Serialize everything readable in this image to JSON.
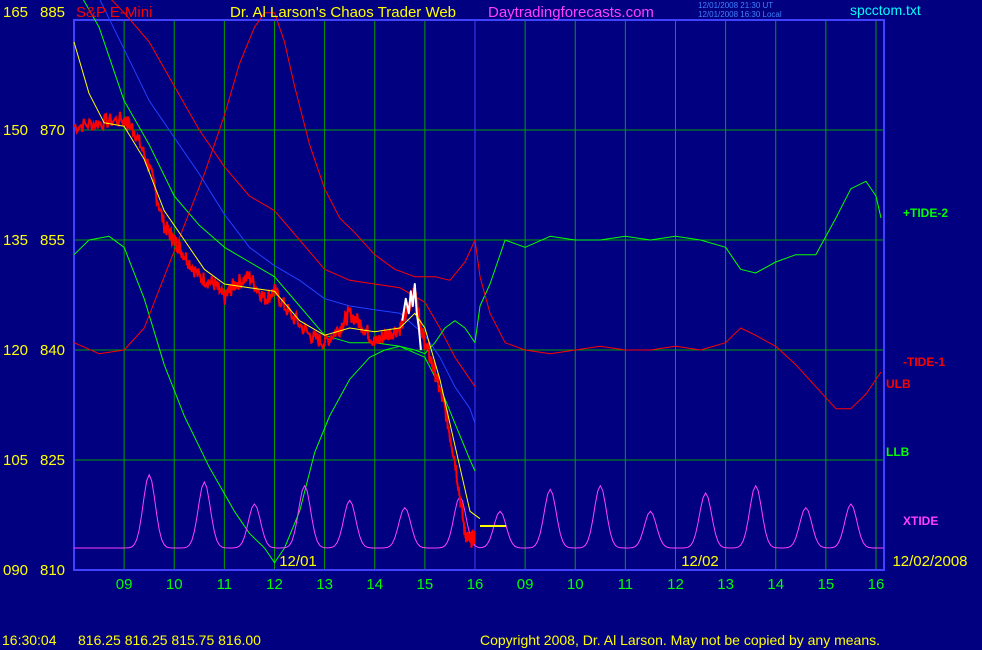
{
  "header": {
    "left_scale_top": "165",
    "price_top": "885",
    "symbol": "S&P E-Mini",
    "title": "Dr. Al Larson's Chaos Trader Web",
    "site": "Daytradingforecasts.com",
    "stamp_line1": "12/01/2008 21:30 UT",
    "stamp_line2": "12/01/2008 16:30 Local",
    "file": "spcctom.txt"
  },
  "footer": {
    "time": "16:30:04",
    "quote": "816.25 816.25 815.75 816.00",
    "copyright": "Copyright 2008, Dr. Al Larson. May not be copied by any means."
  },
  "colors": {
    "background": "#000080",
    "grid": "#00a000",
    "axis": "#4040ff",
    "price": "#ff0000",
    "price_recent": "#ffffff",
    "sma": "#ffff00",
    "tide_pos": "#00ff00",
    "tide_neg": "#ff0000",
    "ulb": "#ff0000",
    "llb": "#00ff00",
    "xtide": "#ff40ff",
    "title": "#ffff00",
    "site": "#ff40ff",
    "file": "#00ffff"
  },
  "chart_data": {
    "type": "line",
    "title": "S&P E-Mini",
    "y_left_ticks": [
      "165",
      "150",
      "135",
      "120",
      "105",
      "090"
    ],
    "y_right_ticks": [
      "885",
      "870",
      "855",
      "840",
      "825",
      "810"
    ],
    "ylim": [
      810,
      885
    ],
    "xlim": [
      8.0,
      16.16
    ],
    "x_hour_ticks": [
      "09",
      "10",
      "11",
      "12",
      "13",
      "14",
      "15",
      "16",
      "09",
      "10",
      "11",
      "12",
      "13",
      "14",
      "15",
      "16"
    ],
    "date_labels": [
      "12/01",
      "12/02",
      "12/02/2008"
    ],
    "series_labels": [
      "+TIDE-2",
      "-TIDE-1",
      "ULB",
      "LLB",
      "XTIDE"
    ],
    "price": {
      "x": [
        8.0,
        8.5,
        9.0,
        9.2,
        9.5,
        9.8,
        10.0,
        10.2,
        10.5,
        10.8,
        11.0,
        11.2,
        11.5,
        11.8,
        12.0,
        12.3,
        12.7,
        13.0,
        13.3,
        13.5,
        13.8,
        14.0,
        14.2,
        14.5,
        14.7,
        14.8,
        14.9,
        15.0,
        15.2,
        15.4,
        15.6,
        15.8,
        15.9,
        16.0
      ],
      "y": [
        870.5,
        871,
        871.5,
        870,
        865,
        857,
        855,
        853,
        850,
        849,
        847,
        849,
        850,
        847,
        848,
        845,
        842,
        841,
        843,
        845,
        843,
        841,
        842,
        843,
        846,
        848,
        844,
        841,
        837,
        832,
        825,
        815,
        814,
        814.5
      ]
    },
    "price_recent": {
      "x": [
        14.55,
        14.62,
        14.68,
        14.72,
        14.76,
        14.8,
        14.84,
        14.88,
        14.92
      ],
      "y": [
        844,
        847,
        845,
        848,
        846,
        849,
        845,
        843,
        840
      ]
    },
    "sma": {
      "x": [
        8.0,
        8.3,
        8.6,
        9.0,
        9.4,
        9.8,
        10.2,
        10.6,
        11.0,
        11.5,
        12.0,
        12.5,
        13.0,
        13.5,
        14.0,
        14.5,
        14.8,
        15.0,
        15.3,
        15.6,
        15.9,
        16.1
      ],
      "y": [
        882,
        875,
        871,
        870.5,
        866,
        859,
        855,
        851,
        849,
        848.5,
        848,
        844,
        842,
        843,
        842.5,
        843,
        845,
        843,
        836,
        827,
        818,
        817
      ]
    },
    "tide_plus_2": {
      "x": [
        8.0,
        8.3,
        8.7,
        9.0,
        9.4,
        9.8,
        10.2,
        10.7,
        11.2,
        11.5,
        11.8,
        12.0,
        12.2,
        12.5,
        12.8,
        13.1,
        13.5,
        13.9,
        14.2,
        14.5,
        14.8,
        15.0,
        15.2,
        15.4,
        15.6,
        15.8,
        16.0,
        16.1,
        16.3,
        16.6,
        17.0,
        17.5,
        18.0,
        18.5,
        19.0,
        19.5,
        20.0,
        20.5,
        21.0,
        21.3,
        21.6,
        22.0,
        22.4,
        22.8,
        23.2,
        23.5,
        23.8,
        24.0,
        24.1
      ],
      "y": [
        853,
        855,
        855.5,
        854,
        847,
        838,
        831,
        824,
        818,
        815,
        813,
        811,
        813,
        818,
        826,
        831,
        836,
        839,
        840,
        840.5,
        840,
        839.5,
        841,
        843,
        844,
        843,
        841,
        846,
        849,
        855,
        854,
        855.5,
        855,
        855,
        855.5,
        855,
        855.5,
        855,
        854,
        851,
        850.5,
        852,
        853,
        853,
        858,
        862,
        863,
        861,
        858
      ]
    },
    "tide_minus_1": {
      "x": [
        8.0,
        8.5,
        9.0,
        9.4,
        9.8,
        10.2,
        10.6,
        11.0,
        11.3,
        11.6,
        11.8,
        12.0,
        12.2,
        12.4,
        12.7,
        13.0,
        13.3,
        13.6,
        14.0,
        14.4,
        14.8,
        15.2,
        15.5,
        15.8,
        16.0,
        16.1,
        16.3,
        16.6,
        17.0,
        17.5,
        18.0,
        18.5,
        19.0,
        19.5,
        20.0,
        20.5,
        21.0,
        21.3,
        21.6,
        22.0,
        22.4,
        22.8,
        23.2,
        23.5,
        23.8,
        24.1
      ],
      "y": [
        841,
        839.5,
        840,
        843,
        850,
        857,
        864,
        872,
        879,
        884,
        886,
        886,
        882,
        876,
        868,
        862,
        858,
        856,
        853,
        851,
        850,
        850,
        849.5,
        852,
        855,
        850,
        845,
        841,
        840,
        839.5,
        840,
        840.5,
        840,
        840,
        840.5,
        840,
        841,
        843,
        842,
        840.5,
        838,
        835,
        832,
        832,
        834,
        837
      ]
    },
    "ulb": {
      "x": [
        8.0,
        8.5,
        9.0,
        9.5,
        10.0,
        10.5,
        11.0,
        11.5,
        12.0,
        12.5,
        13.0,
        13.5,
        14.0,
        14.5,
        15.0,
        15.3,
        15.6,
        15.9,
        16.0
      ],
      "y": [
        890,
        889.5,
        886,
        882,
        876,
        870,
        865,
        861,
        859,
        855,
        851,
        849.5,
        849,
        848.5,
        846.5,
        843,
        839,
        836,
        835
      ]
    },
    "upper_blue": {
      "x": [
        8.0,
        8.5,
        9.0,
        9.5,
        10.0,
        10.5,
        11.0,
        11.5,
        12.0,
        12.5,
        13.0,
        13.5,
        14.0,
        14.5,
        15.0,
        15.3,
        15.6,
        15.9,
        16.0
      ],
      "y": [
        890,
        888,
        881,
        874,
        869,
        864,
        858.5,
        854,
        851.5,
        849.5,
        847,
        846,
        845.5,
        845,
        842,
        839,
        835,
        832,
        830
      ]
    },
    "llb": {
      "x": [
        8.0,
        8.5,
        9.0,
        9.5,
        10.0,
        10.5,
        11.0,
        11.5,
        12.0,
        12.5,
        13.0,
        13.5,
        14.0,
        14.5,
        15.0,
        15.3,
        15.6,
        15.9,
        16.0
      ],
      "y": [
        890,
        884,
        874,
        868,
        861,
        857,
        854,
        852,
        850,
        846,
        842,
        841,
        841,
        840.5,
        839,
        835,
        830,
        825,
        823.5
      ]
    },
    "xtide": {
      "peaks": [
        9.5,
        10.6,
        11.6,
        12.6,
        13.5,
        14.6,
        15.7,
        16.5,
        17.5,
        18.5,
        19.5,
        20.6,
        21.6,
        22.6,
        23.5
      ],
      "peak_values": [
        823,
        822,
        819,
        821.5,
        819.5,
        818.5,
        820,
        818,
        821,
        821.5,
        818,
        820.5,
        821.5,
        818.5,
        819
      ],
      "base_value": 813
    },
    "marker": {
      "x": 16.3,
      "y": 816
    }
  }
}
